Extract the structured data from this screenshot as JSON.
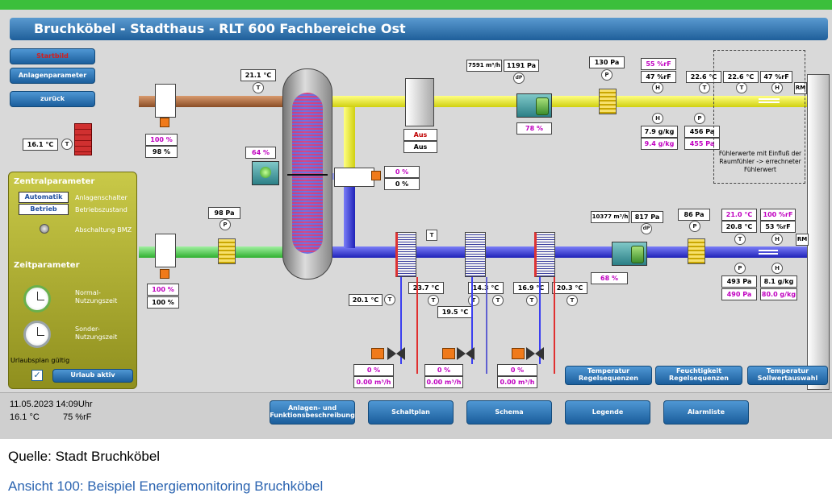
{
  "title": "Bruchköbel - Stadthaus - RLT 600 Fachbereiche Ost",
  "nav": {
    "startbild": "Startbild",
    "anlagenparameter": "Anlagenparameter",
    "zurueck": "zurück"
  },
  "outdoor_temp": "16.1 °C",
  "exhaust": {
    "temp_after_damper": "21.1 °C",
    "damper_pct1": "100 %",
    "damper_pct2": "98 %",
    "recovery_pct": "64 %",
    "bypass_pct1": "0 %",
    "bypass_pct2": "0 %",
    "aus1": "Aus",
    "aus2": "Aus",
    "flow": "7591 m³/h",
    "fan_pressure": "1191 Pa",
    "fan_speed": "78 %",
    "filter_pressure": "130 Pa",
    "rh_setpoint": "55 %rF",
    "rh_actual": "47 %rF",
    "temp_a": "22.6 °C",
    "temp_b": "22.6 °C",
    "rh_room": "47 %rF",
    "abs_hum1": "7.9 g/kg",
    "abs_hum2": "9.4 g/kg",
    "press1": "456 Pa",
    "press2": "455 Pa",
    "note": "Fühlerwerte mit Einfluß der Raumfühler -> errechneter Fühlerwert",
    "rm": "RM"
  },
  "supply": {
    "filter_pressure": "98 Pa",
    "damper_pct1": "100 %",
    "damper_pct2": "100 %",
    "temp_in": "20.1 °C",
    "temp_after_heater": "23.7 °C",
    "temp_after_cooler": "14.3 °C",
    "temp_mid": "19.5 °C",
    "temp_after_reheat": "16.9 °C",
    "temp_out": "20.3 °C",
    "valve1_pct": "0 %",
    "valve1_flow": "0.00 m³/h",
    "valve2_pct": "0 %",
    "valve2_flow": "0.00 m³/h",
    "valve3_pct": "0 %",
    "valve3_flow": "0.00 m³/h",
    "flow": "10377 m³/h",
    "fan_pressure": "817 Pa",
    "fan_speed": "68 %",
    "filter2_pressure": "86 Pa",
    "temp_set": "21.0 °C",
    "temp_act": "20.8 °C",
    "rh_set": "100 %rF",
    "rh_act": "53 %rF",
    "press1": "493 Pa",
    "press2": "490 Pa",
    "abs_hum1": "8.1 g/kg",
    "abs_hum2": "80.0 g/kg",
    "rm": "RM"
  },
  "zentral": {
    "title": "Zentralparameter",
    "mode_value": "Automatik",
    "mode_label": "Anlagenschalter",
    "state_value": "Betrieb",
    "state_label": "Betriebszustand",
    "bmz_label": "Abschaltung BMZ",
    "zeit_title": "Zeitparameter",
    "normal": "Normal-\nNutzungszeit",
    "sonder": "Sonder-\nNutzungszeit",
    "urlaub_label": "Urlaubsplan gültig",
    "urlaub_button": "Urlaub aktiv"
  },
  "right_buttons": {
    "temp_seq": "Temperatur\nRegelsequenzen",
    "feucht_seq": "Feuchtigkeit\nRegelsequenzen",
    "temp_soll": "Temperatur\nSollwertauswahl"
  },
  "status": {
    "datetime": "11.05.2023  14:09Uhr",
    "temp": "16.1 °C",
    "rh": "75 %rF"
  },
  "bottom_buttons": {
    "anlagen": "Anlagen- und\nFunktionsbeschreibung",
    "schaltplan": "Schaltplan",
    "schema": "Schema",
    "legende": "Legende",
    "alarmliste": "Alarmliste"
  },
  "caption_source": "Quelle: Stadt Bruchköbel",
  "caption_link": "Ansicht 100: Beispiel Energiemonitoring Bruchköbel",
  "colors": {
    "exhaust_pipe": "#f0f030",
    "outside_pipe": "#b5764a",
    "supply_pipe": "#3b3ff0",
    "intake_pipe": "#5fe05f",
    "title_bar": "#1f5f9a",
    "panel": "#b0b030"
  }
}
